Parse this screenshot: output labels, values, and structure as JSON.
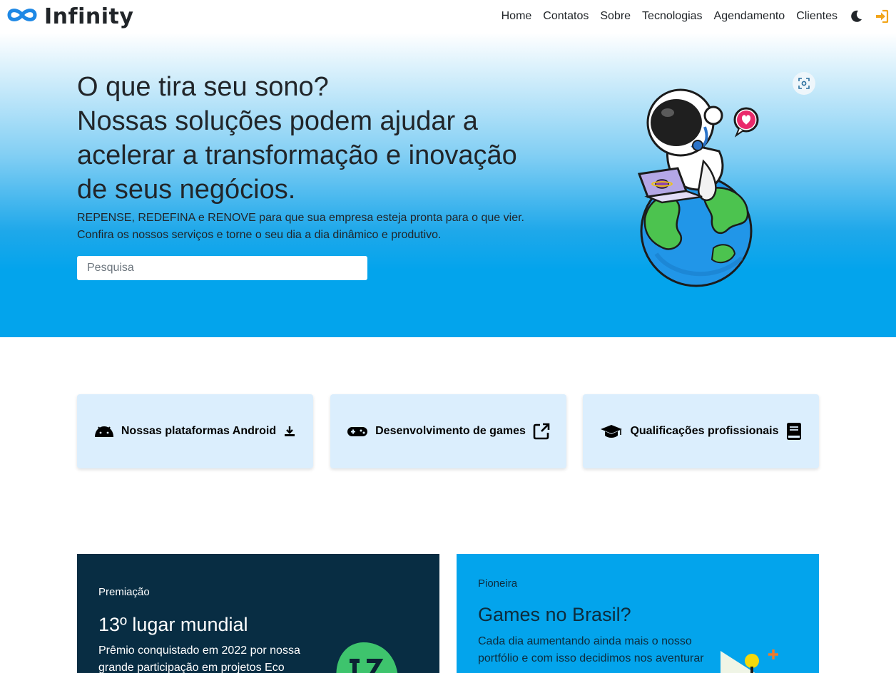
{
  "brand": {
    "name": "Infinity"
  },
  "nav": {
    "links": [
      "Home",
      "Contatos",
      "Sobre",
      "Tecnologias",
      "Agendamento",
      "Clientes"
    ],
    "theme_icon": "moon-icon",
    "login_icon": "sign-in-icon"
  },
  "hero": {
    "title_lines": [
      "O que tira seu sono?",
      "Nossas soluções podem ajudar a",
      "acelerar a transformação e inovação",
      "de seus negócios."
    ],
    "subtitle_lines": [
      "REPENSE, REDEFINA e RENOVE para que sua empresa esteja pronta para o que vier.",
      "Confira os nossos serviços e torne o seu dia a dia dinâmico e produtivo."
    ],
    "search_placeholder": "Pesquisa",
    "zoom_icon": "visual-search-icon",
    "illustration": "astronaut-on-globe-illustration"
  },
  "cards": [
    {
      "label": "Nossas plataformas Android",
      "left_icon": "android-icon",
      "right_icon": "download-icon"
    },
    {
      "label": "Desenvolvimento de games",
      "left_icon": "gamepad-icon",
      "right_icon": "external-link-icon"
    },
    {
      "label": "Qualificações profissionais",
      "left_icon": "graduation-cap-icon",
      "right_icon": "book-icon"
    }
  ],
  "panels": [
    {
      "kicker": "Premiação",
      "title": "13º lugar mundial",
      "text_lines": [
        "Prêmio conquistado em 2022 por nossa",
        "grande participação em projetos Eco"
      ]
    },
    {
      "kicker": "Pioneira",
      "title": "Games no Brasil?",
      "text_lines": [
        "Cada dia aumentando ainda mais o nosso",
        "portfólio e com isso decidimos nos aventurar"
      ]
    }
  ],
  "colors": {
    "hero_blue": "#03a4ec",
    "card_bg": "#dbeefd",
    "panel_dark": "#082d43",
    "panel_blue": "#03a4ec",
    "accent_orange": "#f2a51a",
    "brand_blue": "#1e88e5"
  }
}
